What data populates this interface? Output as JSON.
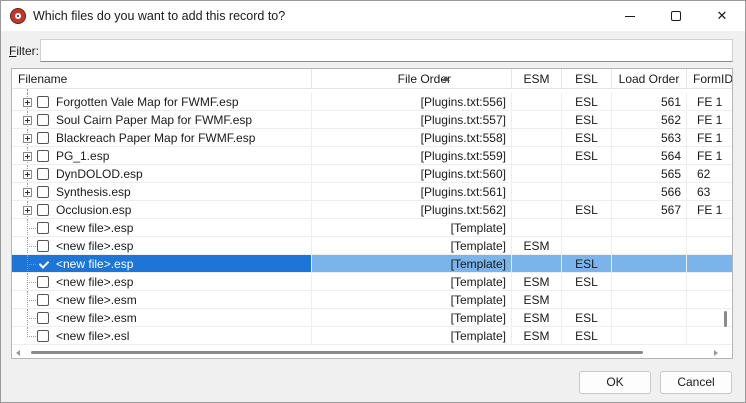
{
  "window": {
    "title": "Which files do you want to add this record to?",
    "close_glyph": "✕"
  },
  "filter": {
    "label_accel": "F",
    "label_rest": "ilter:",
    "value": ""
  },
  "columns": {
    "filename": "Filename",
    "file_order": "File Order",
    "esm": "ESM",
    "esl": "ESL",
    "load_order": "Load Order",
    "form_id": "FormID"
  },
  "rows": [
    {
      "name": "Forgotten Vale Map for FWMF.esp",
      "order": "[Plugins.txt:556]",
      "esm": "",
      "esl": "ESL",
      "load_order": "561",
      "form_id": "FE 1",
      "expandable": true,
      "checked": false,
      "selected": false
    },
    {
      "name": "Soul Cairn Paper Map for FWMF.esp",
      "order": "[Plugins.txt:557]",
      "esm": "",
      "esl": "ESL",
      "load_order": "562",
      "form_id": "FE 1",
      "expandable": true,
      "checked": false,
      "selected": false
    },
    {
      "name": "Blackreach Paper Map for FWMF.esp",
      "order": "[Plugins.txt:558]",
      "esm": "",
      "esl": "ESL",
      "load_order": "563",
      "form_id": "FE 1",
      "expandable": true,
      "checked": false,
      "selected": false
    },
    {
      "name": "PG_1.esp",
      "order": "[Plugins.txt:559]",
      "esm": "",
      "esl": "ESL",
      "load_order": "564",
      "form_id": "FE 1",
      "expandable": true,
      "checked": false,
      "selected": false
    },
    {
      "name": "DynDOLOD.esp",
      "order": "[Plugins.txt:560]",
      "esm": "",
      "esl": "",
      "load_order": "565",
      "form_id": "62",
      "expandable": true,
      "checked": false,
      "selected": false
    },
    {
      "name": "Synthesis.esp",
      "order": "[Plugins.txt:561]",
      "esm": "",
      "esl": "",
      "load_order": "566",
      "form_id": "63",
      "expandable": true,
      "checked": false,
      "selected": false
    },
    {
      "name": "Occlusion.esp",
      "order": "[Plugins.txt:562]",
      "esm": "",
      "esl": "ESL",
      "load_order": "567",
      "form_id": "FE 1",
      "expandable": true,
      "checked": false,
      "selected": false
    },
    {
      "name": "<new file>.esp",
      "order": "[Template]",
      "esm": "",
      "esl": "",
      "load_order": "",
      "form_id": "",
      "expandable": false,
      "checked": false,
      "selected": false
    },
    {
      "name": "<new file>.esp",
      "order": "[Template]",
      "esm": "ESM",
      "esl": "",
      "load_order": "",
      "form_id": "",
      "expandable": false,
      "checked": false,
      "selected": false
    },
    {
      "name": "<new file>.esp",
      "order": "[Template]",
      "esm": "",
      "esl": "ESL",
      "load_order": "",
      "form_id": "",
      "expandable": false,
      "checked": true,
      "selected": true
    },
    {
      "name": "<new file>.esp",
      "order": "[Template]",
      "esm": "ESM",
      "esl": "ESL",
      "load_order": "",
      "form_id": "",
      "expandable": false,
      "checked": false,
      "selected": false
    },
    {
      "name": "<new file>.esm",
      "order": "[Template]",
      "esm": "ESM",
      "esl": "",
      "load_order": "",
      "form_id": "",
      "expandable": false,
      "checked": false,
      "selected": false
    },
    {
      "name": "<new file>.esm",
      "order": "[Template]",
      "esm": "ESM",
      "esl": "ESL",
      "load_order": "",
      "form_id": "",
      "expandable": false,
      "checked": false,
      "selected": false
    },
    {
      "name": "<new file>.esl",
      "order": "[Template]",
      "esm": "ESM",
      "esl": "ESL",
      "load_order": "",
      "form_id": "",
      "expandable": false,
      "checked": false,
      "selected": false
    }
  ],
  "buttons": {
    "ok": "OK",
    "cancel": "Cancel"
  }
}
